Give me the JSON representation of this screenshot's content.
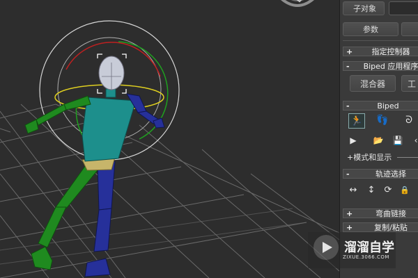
{
  "panel": {
    "subobject_label": "子对象",
    "params_label": "参数",
    "rollouts": {
      "assign_controller": {
        "sign": "+",
        "title": "指定控制器"
      },
      "biped_app": {
        "sign": "-",
        "title": "Biped 应用程序"
      },
      "biped": {
        "sign": "-",
        "title": "Biped"
      },
      "track_selection": {
        "sign": "-",
        "title": "轨迹选择"
      },
      "bend_links": {
        "sign": "+",
        "title": "弯曲链接"
      },
      "copy_paste": {
        "sign": "+",
        "title": "复制/粘贴"
      }
    },
    "mixer_button": "混合器",
    "workbench_button_partial": "工",
    "mode_display": "+模式和显示",
    "icons": {
      "figure_mode": "🏃",
      "footstep_mode": "👣",
      "motion_flow": "ᘐ",
      "play_biped": "▶",
      "load_file": "📂",
      "save_file": "💾",
      "move_all": "↔",
      "vertical": "↕",
      "rotate": "⟳",
      "lock": "🔒",
      "more": "‹"
    }
  },
  "watermark": {
    "brand": "溜溜自学",
    "url": "ZIXUE.3066.COM"
  },
  "colors": {
    "viewport_bg": "#2d2d2d",
    "grid": "#6a6a6a",
    "left_limb": "#1f8a1f",
    "right_limb": "#26309a",
    "torso": "#1d8f8c",
    "head": "#c8ccd8",
    "pelvis": "#c7b56a"
  }
}
